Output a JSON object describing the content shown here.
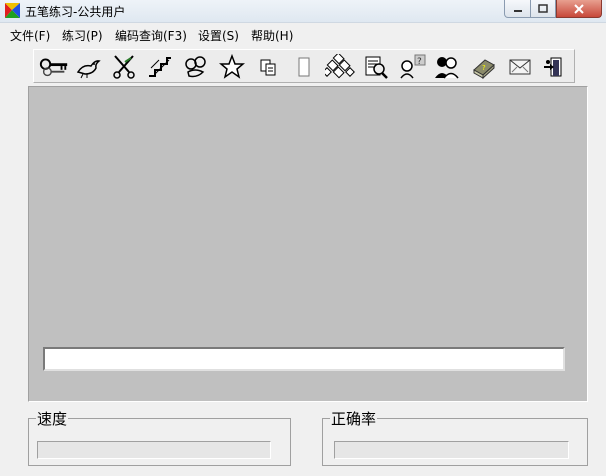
{
  "window": {
    "title": "五笔练习-公共用户"
  },
  "menu": [
    {
      "label": "文件(F)"
    },
    {
      "label": "练习(P)"
    },
    {
      "label": "编码查询(F3)"
    },
    {
      "label": "设置(S)"
    },
    {
      "label": "帮助(H)"
    }
  ],
  "toolbar": {
    "icons": [
      "key-icon",
      "bird-icon",
      "scissors-icon",
      "stairs-icon",
      "flowers-icon",
      "star-icon",
      "copy-icon",
      "blank-icon",
      "keyboard-icon",
      "search-doc-icon",
      "help-person-icon",
      "users-icon",
      "book-icon",
      "envelope-icon",
      "exit-icon"
    ]
  },
  "input": {
    "value": ""
  },
  "stats": {
    "speed_label": "速度",
    "accuracy_label": "正确率"
  },
  "colors": {
    "panel": "#c0c0c0",
    "window_bg": "#f0f0f0",
    "close_button": "#c7483a"
  }
}
